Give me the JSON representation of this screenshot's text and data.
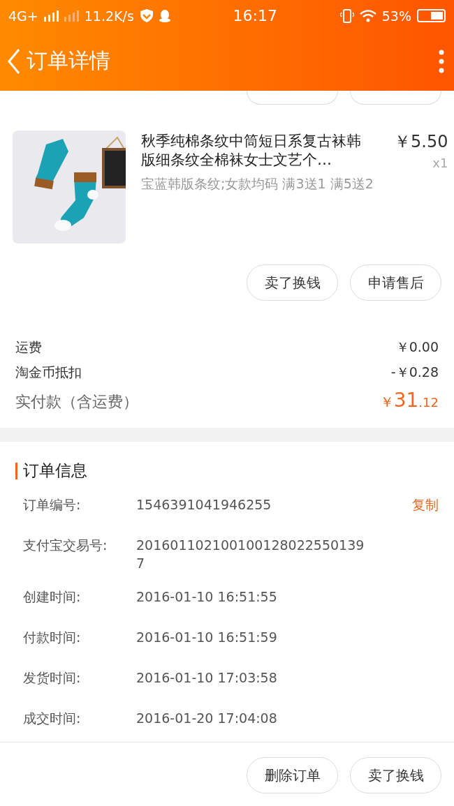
{
  "status_bar": {
    "network": "4G+",
    "speed": "11.2K/s",
    "time": "16:17",
    "battery": "53%"
  },
  "header": {
    "title": "订单详情"
  },
  "item": {
    "kind": "picture",
    "title": "秋季纯棉条纹中筒短日系复古袜韩版细条纹全棉袜女士文艺个…",
    "price": "￥5.50",
    "quantity": "x1",
    "spec": "宝蓝韩版条纹;女款均码 满3送1 满5送2"
  },
  "item_actions": [
    "卖了换钱",
    "申请售后"
  ],
  "summary": [
    {
      "label": "运费",
      "value": "￥0.00"
    },
    {
      "label": "淘金币抵扣",
      "value": "-￥0.28"
    }
  ],
  "total": {
    "label": "实付款（含运费）",
    "currency": "￥",
    "integer": "31",
    "decimal": ".12"
  },
  "order_info": {
    "title": "订单信息",
    "rows": [
      {
        "label": "订单编号:",
        "value": "1546391041946255",
        "action": "复制"
      },
      {
        "label": "支付宝交易号:",
        "value": "2016011021001001280225501397"
      },
      {
        "label": "创建时间:",
        "value": "2016-01-10 16:51:55"
      },
      {
        "label": "付款时间:",
        "value": "2016-01-10 16:51:59"
      },
      {
        "label": "发货时间:",
        "value": "2016-01-10 17:03:58"
      },
      {
        "label": "成交时间:",
        "value": "2016-01-20 17:04:08"
      }
    ]
  },
  "bottom_actions": [
    "删除订单",
    "卖了换钱"
  ]
}
